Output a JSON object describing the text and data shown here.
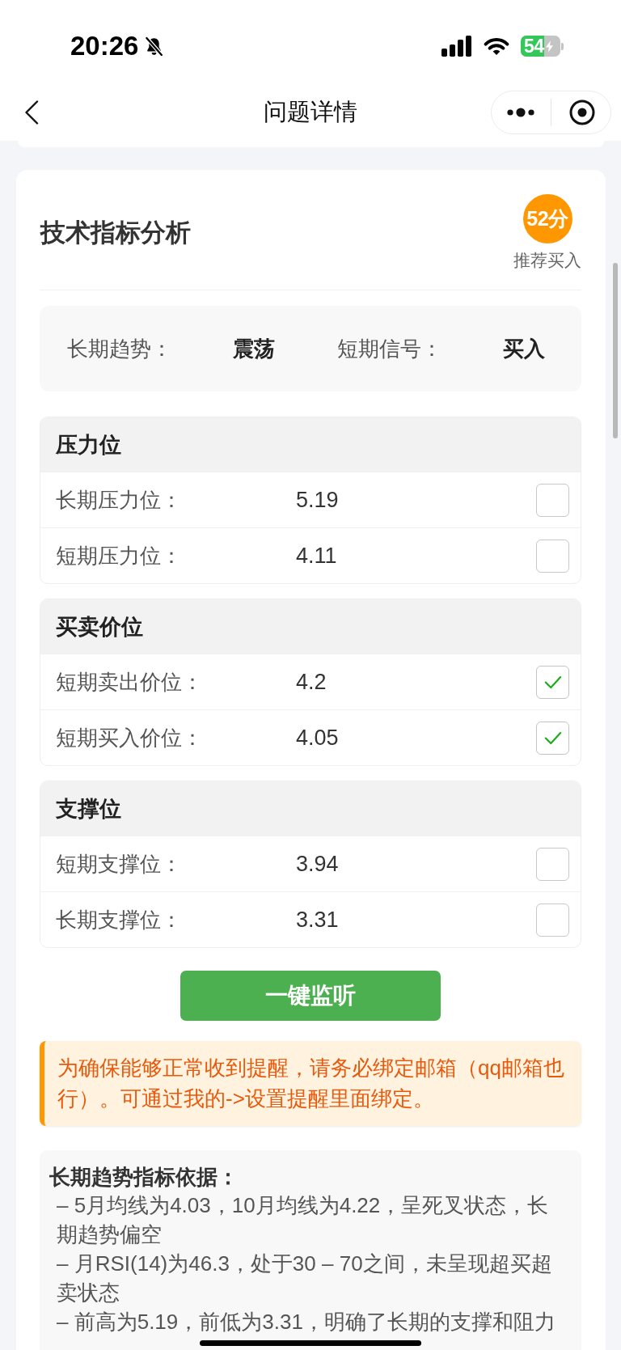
{
  "status_bar": {
    "time": "20:26",
    "battery": "54"
  },
  "nav_bar": {
    "title": "问题详情"
  },
  "card": {
    "title": "技术指标分析",
    "score": "52分",
    "recommendation": "推荐买入",
    "summary": [
      {
        "label": "长期趋势：",
        "value": "震荡"
      },
      {
        "label": "短期信号：",
        "value": "买入"
      }
    ],
    "sections": [
      {
        "title": "压力位",
        "rows": [
          {
            "label": "长期压力位：",
            "value": "5.19",
            "checked": false
          },
          {
            "label": "短期压力位：",
            "value": "4.11",
            "checked": false
          }
        ]
      },
      {
        "title": "买卖价位",
        "rows": [
          {
            "label": "短期卖出价位：",
            "value": "4.2",
            "checked": true
          },
          {
            "label": "短期买入价位：",
            "value": "4.05",
            "checked": true
          }
        ]
      },
      {
        "title": "支撑位",
        "rows": [
          {
            "label": "短期支撑位：",
            "value": "3.94",
            "checked": false
          },
          {
            "label": "长期支撑位：",
            "value": "3.31",
            "checked": false
          }
        ]
      }
    ],
    "button": "一键监听",
    "notice": "为确保能够正常收到提醒，请务必绑定邮箱（qq邮箱也行）。可通过我的->设置提醒里面绑定。",
    "basis": {
      "title": "长期趋势指标依据：",
      "items": [
        "– 5月均线为4.03，10月均线为4.22，呈死叉状态，长期趋势偏空",
        "– 月RSI(14)为46.3，处于30 – 70之间，未呈现超买超卖状态",
        "– 前高为5.19，前低为3.31，明确了长期的支撑和阻力"
      ]
    }
  }
}
